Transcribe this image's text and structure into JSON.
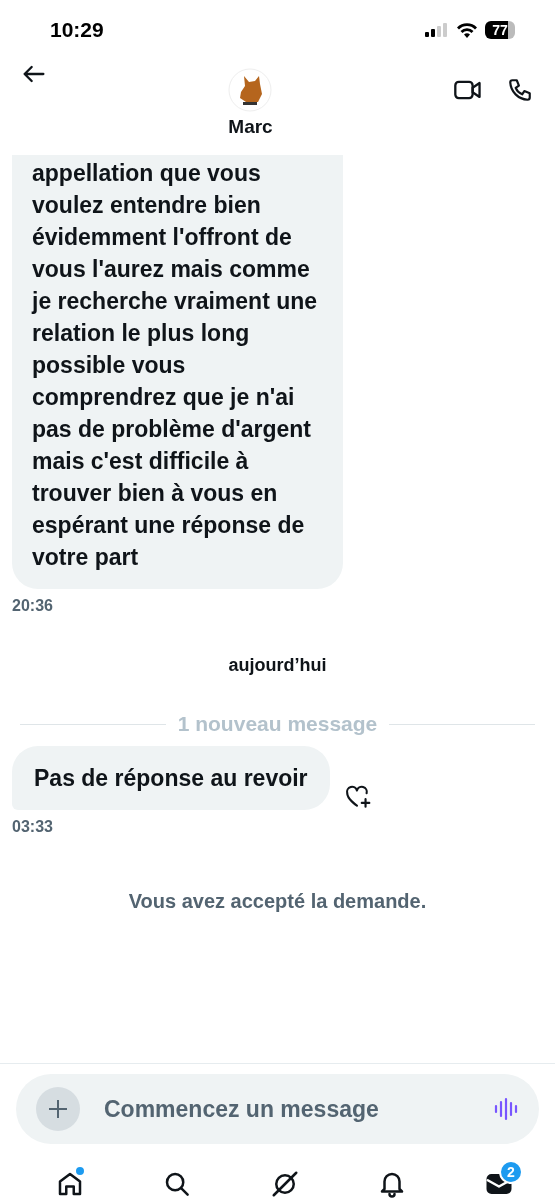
{
  "status_bar": {
    "time": "10:29",
    "battery": "77"
  },
  "header": {
    "name": "Marc"
  },
  "messages": [
    {
      "kind": "bubble",
      "lines": [
        "appellation que vous",
        "voulez entendre bien",
        "évidemment l'offront de",
        "vous l'aurez mais comme",
        "je recherche vraiment une",
        "relation le plus long",
        "possible vous",
        "comprendrez que je n'ai",
        "pas de problème d'argent",
        "mais c'est difficile à",
        "trouver bien à vous en",
        "espérant une réponse de",
        "votre part"
      ],
      "time": "20:36",
      "reaction": false
    },
    {
      "kind": "day",
      "text": "aujourd’hui"
    },
    {
      "kind": "divider",
      "text": "1 nouveau message"
    },
    {
      "kind": "bubble",
      "lines": [
        "Pas de réponse au revoir"
      ],
      "time": "03:33",
      "reaction": true
    },
    {
      "kind": "notice",
      "text": "Vous avez accepté la demande."
    }
  ],
  "composer": {
    "placeholder": "Commencez un message"
  },
  "nav": [
    {
      "kind": "home",
      "selected": false,
      "dot": true
    },
    {
      "kind": "search",
      "selected": false,
      "dot": false
    },
    {
      "kind": "grok",
      "selected": false,
      "dot": false
    },
    {
      "kind": "bell",
      "selected": false,
      "dot": false
    },
    {
      "kind": "mail",
      "selected": true,
      "dot": false,
      "badge": "2"
    }
  ]
}
